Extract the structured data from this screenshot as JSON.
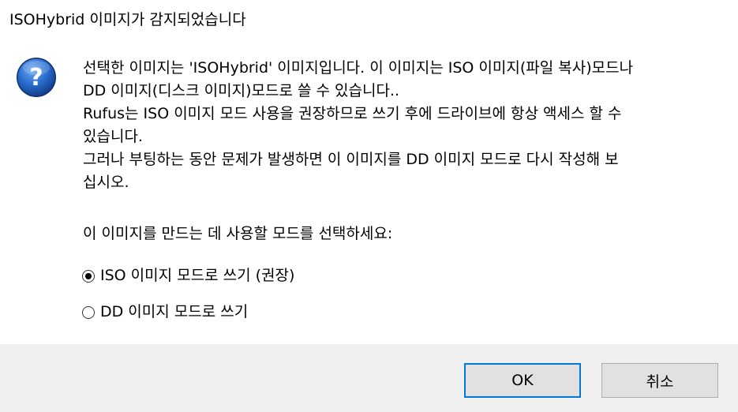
{
  "dialog": {
    "title": "ISOHybrid 이미지가 감지되었습니다",
    "icon": "question-icon",
    "message_lines": [
      "선택한 이미지는 'ISOHybrid' 이미지입니다. 이 이미지는 ISO 이미지(파일 복사)모드나",
      "DD 이미지(디스크 이미지)모드로 쓸 수 있습니다..",
      "Rufus는 ISO 이미지 모드 사용을 권장하므로 쓰기 후에 드라이브에 항상 액세스 할 수",
      "있습니다.",
      "그러나 부팅하는 동안 문제가 발생하면 이 이미지를 DD 이미지 모드로 다시 작성해 보",
      "십시오."
    ],
    "prompt": "이 이미지를 만드는 데 사용할 모드를 선택하세요:",
    "options": [
      {
        "label": "ISO 이미지 모드로 쓰기 (권장)",
        "checked": true
      },
      {
        "label": "DD 이미지 모드로 쓰기",
        "checked": false
      }
    ],
    "buttons": {
      "ok": "OK",
      "cancel": "취소"
    }
  },
  "colors": {
    "footer_background": "#f0f0f0",
    "button_background": "#e1e1e1",
    "focus_border": "#0078d7",
    "icon_blue": "#1f5fb8"
  }
}
